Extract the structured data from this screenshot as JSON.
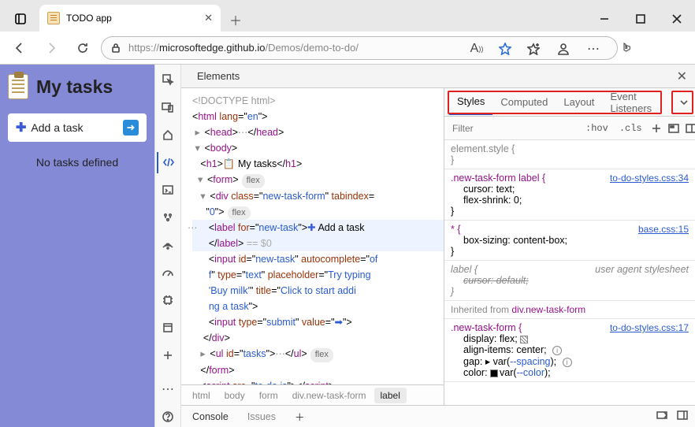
{
  "window": {
    "tab_title": "TODO app",
    "url_scheme": "https://",
    "url_host": "microsoftedge.github.io",
    "url_path": "/Demos/demo-to-do/"
  },
  "app": {
    "title": "My tasks",
    "add_label": "Add a task",
    "empty": "No tasks defined"
  },
  "devtools": {
    "main_tab": "Elements",
    "tree": {
      "doctype": "<!DOCTYPE html>",
      "html_open": "html",
      "html_lang_attr": "lang",
      "html_lang_val": "en",
      "head": "head",
      "body": "body",
      "h1": "h1",
      "h1_text": " My tasks",
      "form": "form",
      "flex_badge": "flex",
      "div": "div",
      "div_class_attr": "class",
      "div_class_val": "new-task-form",
      "div_tab_attr": "tabindex",
      "div_tab_val": "0",
      "label": "label",
      "label_for_attr": "for",
      "label_for_val": "new-task",
      "label_text": " Add a task",
      "eq_s0": "== $0",
      "input": "input",
      "input_id_attr": "id",
      "input_id_val": "new-task",
      "input_ac_attr": "autocomplete",
      "input_ac_val": "off",
      "input_type_attr": "type",
      "input_type_val": "text",
      "input_ph_attr": "placeholder",
      "input_ph_val": "Try typing 'Buy milk'",
      "input_title_attr": "title",
      "input_title_val": "Click to start adding a task",
      "submit_type_val": "submit",
      "submit_value_attr": "value",
      "submit_value_val": "➡",
      "ul": "ul",
      "ul_id_attr": "id",
      "ul_id_val": "tasks",
      "script": "script",
      "script_src_attr": "src",
      "script_src_val": "to-do.js"
    },
    "crumbs": [
      "html",
      "body",
      "form",
      "div.new-task-form",
      "label"
    ],
    "styles": {
      "tabs": [
        "Styles",
        "Computed",
        "Layout",
        "Event Listeners"
      ],
      "filter_placeholder": "Filter",
      "hov": ":hov",
      "cls": ".cls",
      "element_style": "element.style {",
      "r1_selector": ".new-task-form label {",
      "r1_link": "to-do-styles.css:34",
      "r1_p1": "cursor: text;",
      "r1_p2": "flex-shrink: 0;",
      "r2_selector": "* {",
      "r2_link": "base.css:15",
      "r2_p1": "box-sizing: content-box;",
      "r3_selector": "label {",
      "r3_uas": "user agent stylesheet",
      "r3_p1": "cursor: default;",
      "inherited": "Inherited from ",
      "inherited_sel": "div.new-task-form",
      "r4_selector": ".new-task-form {",
      "r4_link": "to-do-styles.css:17",
      "r4_p1": "display: flex;",
      "r4_p2": "align-items: center;",
      "r4_p3a": "gap: ",
      "r4_p3b": "var(",
      "r4_p3c": "--spacing",
      "r4_p3d": ");",
      "r4_p4a": "color: ",
      "r4_p4b": "var(",
      "r4_p4c": "--color",
      "r4_p4d": ");"
    },
    "drawer": {
      "console": "Console",
      "issues": "Issues"
    }
  }
}
